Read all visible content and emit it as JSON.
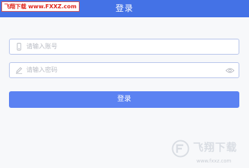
{
  "header": {
    "title": "登录",
    "watermark": "飞翔下载 www.FXXZ.com"
  },
  "form": {
    "account_placeholder": "请输入账号",
    "password_placeholder": "请输入密码",
    "login_label": "登录"
  },
  "watermark": {
    "text": "飞翔下载",
    "url": "www.fxxz.com"
  },
  "colors": {
    "header_bg": "#4472e6",
    "button_bg": "#5b82f2",
    "field_border": "#b5c3ea",
    "page_bg": "#f7f8fa"
  }
}
